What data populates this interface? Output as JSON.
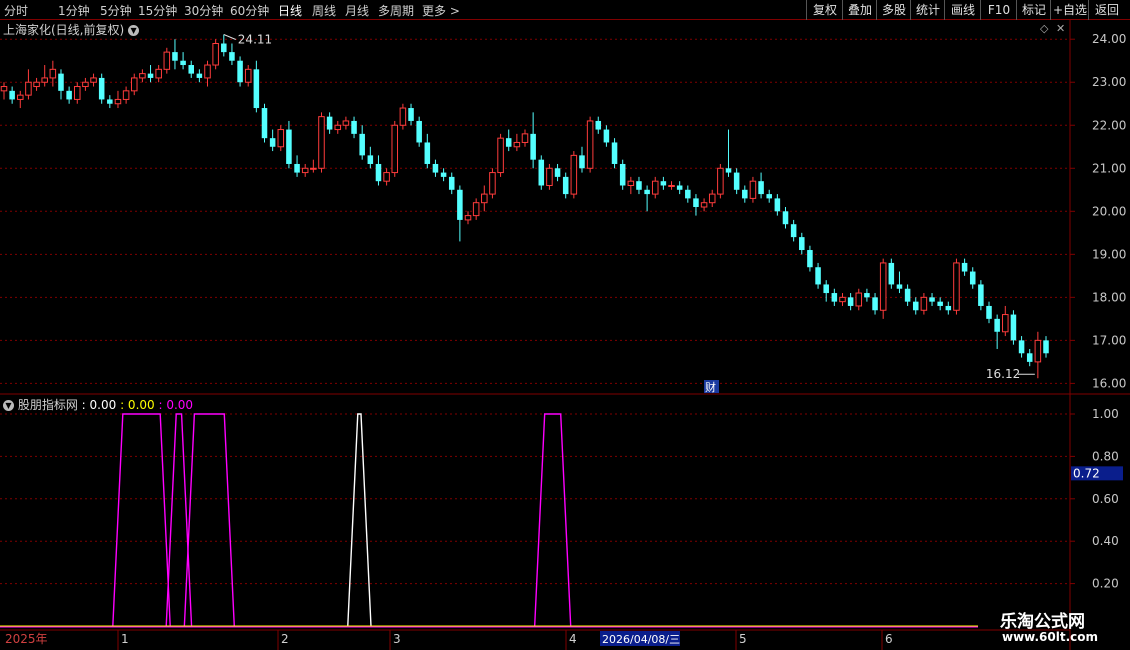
{
  "toolbar": {
    "periods": [
      "分时",
      "1分钟",
      "5分钟",
      "15分钟",
      "30分钟",
      "60分钟",
      "日线",
      "周线",
      "月线",
      "多周期",
      "更多 >"
    ],
    "active_period": "日线",
    "buttons": [
      "复权",
      "叠加",
      "多股",
      "统计",
      "画线",
      "F10",
      "标记",
      "+自选",
      "返回"
    ]
  },
  "main_chart": {
    "title": "上海家化(日线,前复权)",
    "high_label": "24.11",
    "low_label": "16.12",
    "cai_marker": "财",
    "y_axis": {
      "min": 15.8,
      "max": 24.4,
      "ticks": [
        "24.00",
        "23.00",
        "22.00",
        "21.00",
        "20.00",
        "19.00",
        "18.00",
        "17.00",
        "16.00"
      ]
    }
  },
  "indicator": {
    "name": "股朋指标网",
    "values": [
      " : 0.00",
      " : 0.00",
      " : 0.00"
    ],
    "value_colors": [
      "#ffffff",
      "#ffff00",
      "#ff00ff"
    ],
    "y_axis": {
      "ticks": [
        "1.00",
        "0.80",
        "0.60",
        "0.40",
        "0.20"
      ]
    },
    "cursor_value": "0.72"
  },
  "date_axis": {
    "year_label": "2025年",
    "month_labels": [
      "1",
      "2",
      "3",
      "4",
      "5",
      "6"
    ],
    "cursor_date": "2026/04/08/三"
  },
  "watermark": {
    "line1": "乐淘公式网",
    "line2": "www.60lt.com"
  },
  "colors": {
    "up": "#ff3c3c",
    "down": "#54ffff",
    "grid": "#800000",
    "magenta": "#ff00ff",
    "axis_text": "#c8c8c8"
  },
  "chart_data": {
    "type": "candlestick",
    "price_series": [
      [
        22.8,
        23.0,
        22.6,
        22.9
      ],
      [
        22.8,
        22.9,
        22.5,
        22.6
      ],
      [
        22.6,
        22.8,
        22.4,
        22.7
      ],
      [
        22.7,
        23.3,
        22.6,
        23.0
      ],
      [
        22.9,
        23.1,
        22.8,
        23.0
      ],
      [
        23.0,
        23.4,
        22.9,
        23.1
      ],
      [
        23.1,
        23.5,
        22.9,
        23.3
      ],
      [
        23.2,
        23.3,
        22.6,
        22.8
      ],
      [
        22.8,
        22.9,
        22.5,
        22.6
      ],
      [
        22.6,
        23.0,
        22.5,
        22.9
      ],
      [
        22.9,
        23.1,
        22.8,
        23.0
      ],
      [
        23.0,
        23.2,
        22.9,
        23.1
      ],
      [
        23.1,
        23.2,
        22.5,
        22.6
      ],
      [
        22.6,
        22.7,
        22.4,
        22.5
      ],
      [
        22.5,
        22.8,
        22.4,
        22.6
      ],
      [
        22.6,
        22.9,
        22.5,
        22.8
      ],
      [
        22.8,
        23.2,
        22.7,
        23.1
      ],
      [
        23.1,
        23.3,
        23.0,
        23.2
      ],
      [
        23.2,
        23.4,
        23.0,
        23.1
      ],
      [
        23.1,
        23.4,
        23.0,
        23.3
      ],
      [
        23.3,
        23.8,
        23.2,
        23.7
      ],
      [
        23.7,
        24.0,
        23.3,
        23.5
      ],
      [
        23.5,
        23.7,
        23.3,
        23.4
      ],
      [
        23.4,
        23.5,
        23.1,
        23.2
      ],
      [
        23.2,
        23.3,
        23.0,
        23.1
      ],
      [
        23.1,
        23.5,
        22.9,
        23.4
      ],
      [
        23.4,
        24.0,
        23.3,
        23.9
      ],
      [
        23.9,
        24.11,
        23.6,
        23.7
      ],
      [
        23.7,
        23.9,
        23.4,
        23.5
      ],
      [
        23.5,
        23.6,
        22.9,
        23.0
      ],
      [
        23.0,
        23.4,
        22.9,
        23.3
      ],
      [
        23.3,
        23.5,
        22.3,
        22.4
      ],
      [
        22.4,
        22.5,
        21.6,
        21.7
      ],
      [
        21.7,
        21.9,
        21.4,
        21.5
      ],
      [
        21.5,
        22.0,
        21.4,
        21.9
      ],
      [
        21.9,
        22.1,
        21.0,
        21.1
      ],
      [
        21.1,
        21.3,
        20.8,
        20.9
      ],
      [
        20.9,
        21.1,
        20.8,
        21.0
      ],
      [
        21.0,
        21.2,
        20.9,
        21.0
      ],
      [
        21.0,
        22.3,
        20.9,
        22.2
      ],
      [
        22.2,
        22.3,
        21.8,
        21.9
      ],
      [
        21.9,
        22.1,
        21.8,
        22.0
      ],
      [
        22.0,
        22.2,
        21.9,
        22.1
      ],
      [
        22.1,
        22.2,
        21.7,
        21.8
      ],
      [
        21.8,
        22.0,
        21.2,
        21.3
      ],
      [
        21.3,
        21.5,
        21.0,
        21.1
      ],
      [
        21.1,
        21.3,
        20.6,
        20.7
      ],
      [
        20.7,
        21.0,
        20.6,
        20.9
      ],
      [
        20.9,
        22.1,
        20.8,
        22.0
      ],
      [
        22.0,
        22.5,
        21.9,
        22.4
      ],
      [
        22.4,
        22.5,
        22.0,
        22.1
      ],
      [
        22.1,
        22.2,
        21.5,
        21.6
      ],
      [
        21.6,
        21.8,
        21.0,
        21.1
      ],
      [
        21.1,
        21.2,
        20.8,
        20.9
      ],
      [
        20.9,
        21.0,
        20.7,
        20.8
      ],
      [
        20.8,
        20.9,
        20.4,
        20.5
      ],
      [
        20.5,
        20.6,
        19.3,
        19.8
      ],
      [
        19.8,
        20.0,
        19.7,
        19.9
      ],
      [
        19.9,
        20.3,
        19.8,
        20.2
      ],
      [
        20.2,
        20.6,
        20.0,
        20.4
      ],
      [
        20.4,
        21.0,
        20.3,
        20.9
      ],
      [
        20.9,
        21.8,
        20.8,
        21.7
      ],
      [
        21.7,
        21.9,
        21.4,
        21.5
      ],
      [
        21.5,
        21.8,
        21.4,
        21.6
      ],
      [
        21.6,
        21.9,
        21.5,
        21.8
      ],
      [
        21.8,
        22.3,
        21.0,
        21.2
      ],
      [
        21.2,
        21.3,
        20.5,
        20.6
      ],
      [
        20.6,
        21.1,
        20.5,
        21.0
      ],
      [
        21.0,
        21.1,
        20.7,
        20.8
      ],
      [
        20.8,
        20.9,
        20.3,
        20.4
      ],
      [
        20.4,
        21.4,
        20.3,
        21.3
      ],
      [
        21.3,
        21.5,
        20.9,
        21.0
      ],
      [
        21.0,
        22.2,
        20.9,
        22.1
      ],
      [
        22.1,
        22.2,
        21.8,
        21.9
      ],
      [
        21.9,
        22.0,
        21.5,
        21.6
      ],
      [
        21.6,
        21.7,
        21.0,
        21.1
      ],
      [
        21.1,
        21.2,
        20.5,
        20.6
      ],
      [
        20.6,
        20.8,
        20.4,
        20.7
      ],
      [
        20.7,
        20.8,
        20.4,
        20.5
      ],
      [
        20.5,
        20.6,
        20.0,
        20.4
      ],
      [
        20.4,
        20.8,
        20.3,
        20.7
      ],
      [
        20.7,
        20.8,
        20.5,
        20.6
      ],
      [
        20.6,
        20.7,
        20.5,
        20.6
      ],
      [
        20.6,
        20.7,
        20.4,
        20.5
      ],
      [
        20.5,
        20.6,
        20.2,
        20.3
      ],
      [
        20.3,
        20.4,
        19.9,
        20.1
      ],
      [
        20.1,
        20.3,
        20.0,
        20.2
      ],
      [
        20.2,
        20.5,
        20.1,
        20.4
      ],
      [
        20.4,
        21.1,
        20.3,
        21.0
      ],
      [
        21.0,
        21.9,
        20.8,
        20.9
      ],
      [
        20.9,
        21.0,
        20.4,
        20.5
      ],
      [
        20.5,
        20.6,
        20.2,
        20.3
      ],
      [
        20.3,
        20.8,
        20.2,
        20.7
      ],
      [
        20.7,
        20.9,
        20.3,
        20.4
      ],
      [
        20.4,
        20.5,
        20.2,
        20.3
      ],
      [
        20.3,
        20.4,
        19.9,
        20.0
      ],
      [
        20.0,
        20.1,
        19.6,
        19.7
      ],
      [
        19.7,
        19.8,
        19.3,
        19.4
      ],
      [
        19.4,
        19.5,
        19.0,
        19.1
      ],
      [
        19.1,
        19.2,
        18.6,
        18.7
      ],
      [
        18.7,
        18.8,
        18.2,
        18.3
      ],
      [
        18.3,
        18.4,
        17.9,
        18.1
      ],
      [
        18.1,
        18.2,
        17.8,
        17.9
      ],
      [
        17.9,
        18.1,
        17.8,
        18.0
      ],
      [
        18.0,
        18.1,
        17.7,
        17.8
      ],
      [
        17.8,
        18.2,
        17.7,
        18.1
      ],
      [
        18.1,
        18.2,
        17.9,
        18.0
      ],
      [
        18.0,
        18.1,
        17.6,
        17.7
      ],
      [
        17.7,
        18.9,
        17.5,
        18.8
      ],
      [
        18.8,
        18.9,
        18.2,
        18.3
      ],
      [
        18.3,
        18.6,
        18.1,
        18.2
      ],
      [
        18.2,
        18.3,
        17.8,
        17.9
      ],
      [
        17.9,
        18.0,
        17.6,
        17.7
      ],
      [
        17.7,
        18.1,
        17.6,
        18.0
      ],
      [
        18.0,
        18.1,
        17.8,
        17.9
      ],
      [
        17.9,
        18.0,
        17.7,
        17.8
      ],
      [
        17.8,
        17.9,
        17.6,
        17.7
      ],
      [
        17.7,
        18.9,
        17.6,
        18.8
      ],
      [
        18.8,
        18.9,
        18.5,
        18.6
      ],
      [
        18.6,
        18.7,
        18.2,
        18.3
      ],
      [
        18.3,
        18.4,
        17.7,
        17.8
      ],
      [
        17.8,
        17.9,
        17.4,
        17.5
      ],
      [
        17.5,
        17.6,
        16.8,
        17.2
      ],
      [
        17.2,
        17.8,
        17.1,
        17.6
      ],
      [
        17.6,
        17.7,
        16.9,
        17.0
      ],
      [
        17.0,
        17.1,
        16.6,
        16.7
      ],
      [
        16.7,
        16.8,
        16.4,
        16.5
      ],
      [
        16.5,
        17.2,
        16.12,
        17.0
      ],
      [
        17.0,
        17.1,
        16.6,
        16.7
      ]
    ],
    "indicator_series": [
      {
        "color": "#ff00ff",
        "pulses": [
          [
            0.115,
            0.15
          ],
          [
            0.165,
            0.17
          ],
          [
            0.182,
            0.21
          ],
          [
            0.51,
            0.525
          ]
        ]
      },
      {
        "color": "#ffffff",
        "pulses": [
          [
            0.335,
            0.338
          ]
        ]
      }
    ],
    "indicator_ylim": [
      0,
      1
    ]
  }
}
